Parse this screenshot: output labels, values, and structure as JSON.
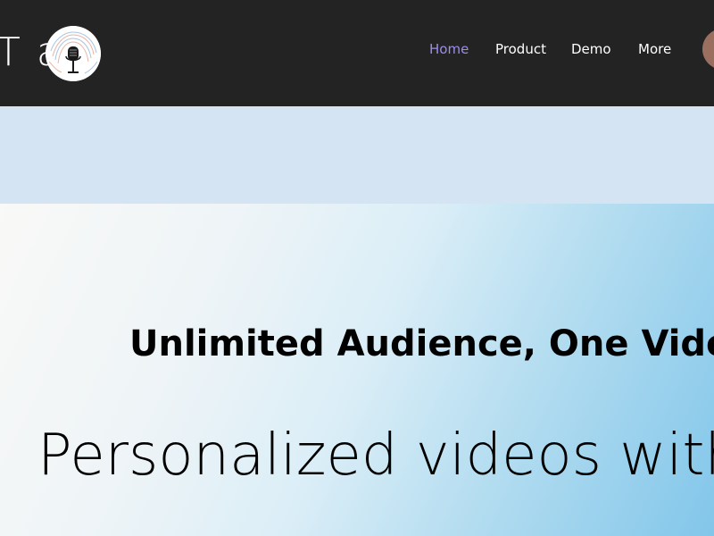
{
  "header": {
    "logo_text": "T a",
    "logo_icon": "microphone-icon",
    "nav": [
      {
        "label": "Home",
        "active": true
      },
      {
        "label": "Product",
        "active": false
      },
      {
        "label": "Demo",
        "active": false
      },
      {
        "label": "More",
        "active": false
      }
    ]
  },
  "hero": {
    "subtitle": "Unlimited Audience, One Video",
    "title": "Personalized videos with"
  },
  "colors": {
    "header_bg": "#232323",
    "nav_active": "#9b8fe8",
    "band_bg": "#d5e4f2",
    "hero_gradient_start": "#f9f9f7",
    "hero_gradient_end": "#82c6ea",
    "avatar": "#9b6f60"
  }
}
